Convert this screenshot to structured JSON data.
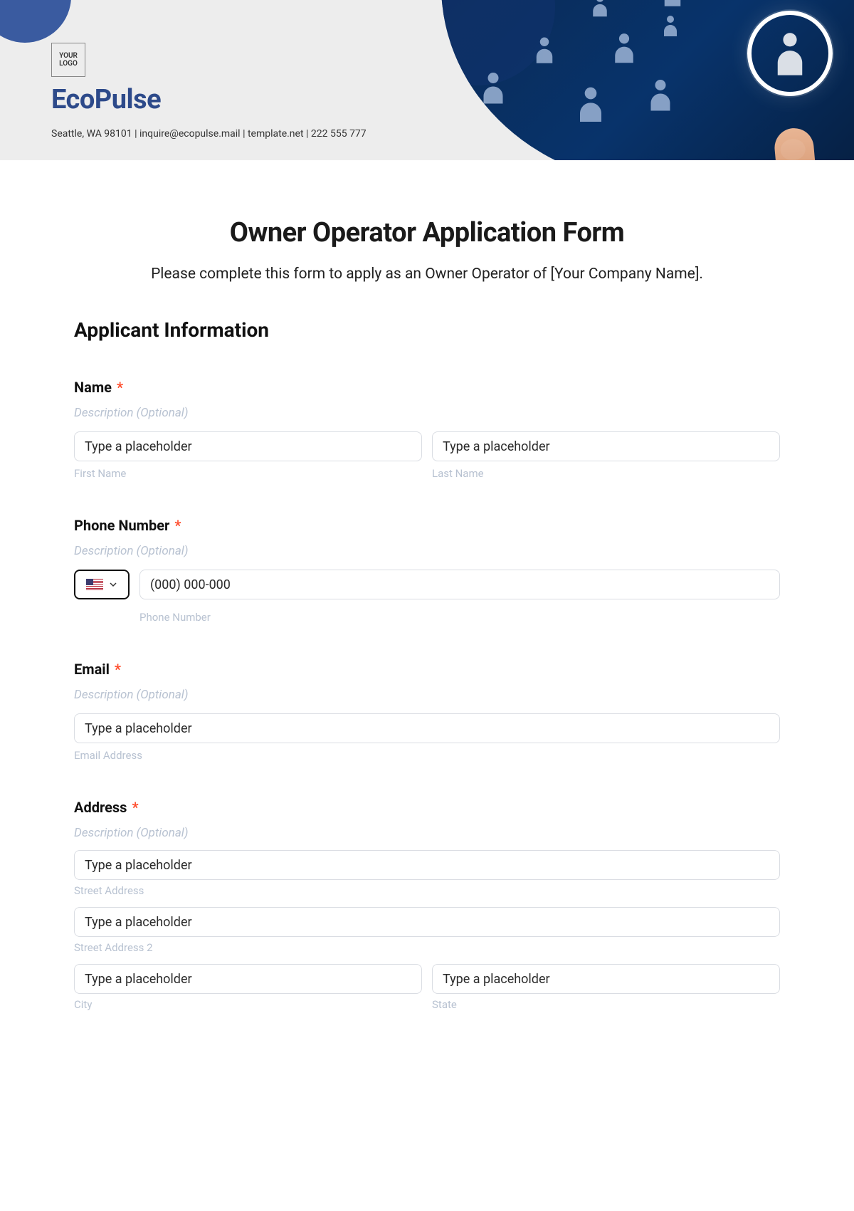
{
  "header": {
    "logo_text": "YOUR\nLOGO",
    "brand": "EcoPulse",
    "contact": "Seattle, WA 98101 | inquire@ecopulse.mail | template.net | 222 555 777"
  },
  "form": {
    "title": "Owner Operator Application Form",
    "subtitle": "Please complete this form to apply as an Owner Operator of [Your Company Name].",
    "section1_heading": "Applicant Information",
    "required_marker": "*",
    "desc_placeholder": "Description (Optional)",
    "input_placeholder": "Type a placeholder",
    "name": {
      "label": "Name",
      "first_sub": "First Name",
      "last_sub": "Last Name"
    },
    "phone": {
      "label": "Phone Number",
      "placeholder": "(000) 000-000",
      "sub": "Phone Number"
    },
    "email": {
      "label": "Email",
      "sub": "Email Address"
    },
    "address": {
      "label": "Address",
      "street1_sub": "Street Address",
      "street2_sub": "Street Address 2",
      "city_sub": "City",
      "state_sub": "State"
    }
  }
}
